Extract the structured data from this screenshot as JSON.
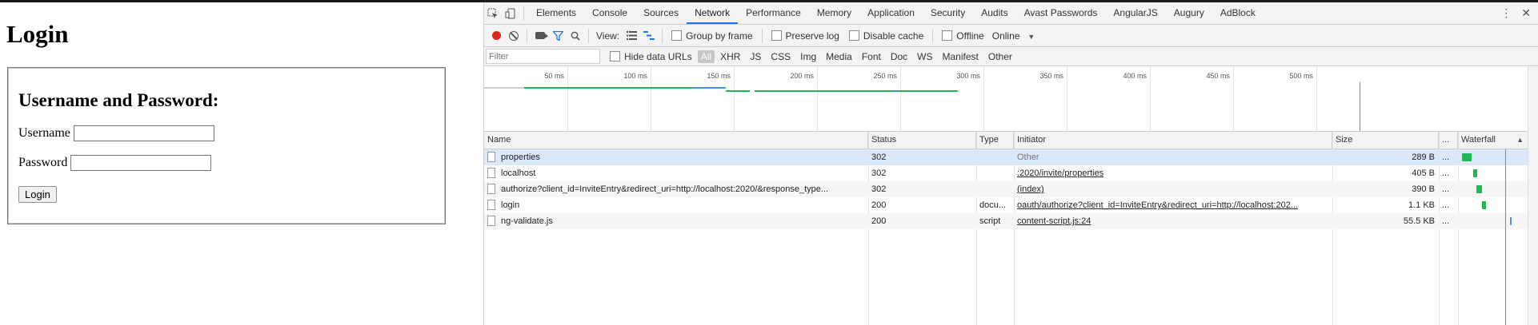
{
  "page": {
    "title": "Login",
    "box_heading": "Username and Password:",
    "username_label": "Username",
    "password_label": "Password",
    "login_button": "Login",
    "username_value": "",
    "password_value": ""
  },
  "devtools": {
    "tabs": [
      "Elements",
      "Console",
      "Sources",
      "Network",
      "Performance",
      "Memory",
      "Application",
      "Security",
      "Audits",
      "Avast Passwords",
      "AngularJS",
      "Augury",
      "AdBlock"
    ],
    "active_tab": "Network",
    "toolbar": {
      "view_label": "View:",
      "group_by_frame": "Group by frame",
      "preserve_log": "Preserve log",
      "disable_cache": "Disable cache",
      "offline": "Offline",
      "throttle": "Online"
    },
    "filter": {
      "placeholder": "Filter",
      "hide_data_urls": "Hide data URLs",
      "types": [
        "All",
        "XHR",
        "JS",
        "CSS",
        "Img",
        "Media",
        "Font",
        "Doc",
        "WS",
        "Manifest",
        "Other"
      ]
    },
    "overview_ticks": [
      "50 ms",
      "100 ms",
      "150 ms",
      "200 ms",
      "250 ms",
      "300 ms",
      "350 ms",
      "400 ms",
      "450 ms",
      "500 ms"
    ],
    "columns": {
      "name": "Name",
      "status": "Status",
      "type": "Type",
      "initiator": "Initiator",
      "size": "Size",
      "time": "...",
      "waterfall": "Waterfall"
    },
    "rows": [
      {
        "name": "properties",
        "status": "302",
        "type": "",
        "initiator": "Other",
        "size": "289 B",
        "time": "..."
      },
      {
        "name": "localhost",
        "status": "302",
        "type": "",
        "initiator": ":2020/invite/properties",
        "size": "405 B",
        "time": "..."
      },
      {
        "name": "authorize?client_id=InviteEntry&redirect_uri=http://localhost:2020/&response_type...",
        "status": "302",
        "type": "",
        "initiator": "(index)",
        "size": "390 B",
        "time": "..."
      },
      {
        "name": "login",
        "status": "200",
        "type": "docu...",
        "initiator": "oauth/authorize?client_id=InviteEntry&redirect_uri=http://localhost:202...",
        "size": "1.1 KB",
        "time": "..."
      },
      {
        "name": "ng-validate.js",
        "status": "200",
        "type": "script",
        "initiator": "content-script.js:24",
        "size": "55.5 KB",
        "time": "..."
      }
    ],
    "colors": {
      "accent": "#1a73e8",
      "record": "#e0261a",
      "waterfall": "#1db954"
    }
  }
}
